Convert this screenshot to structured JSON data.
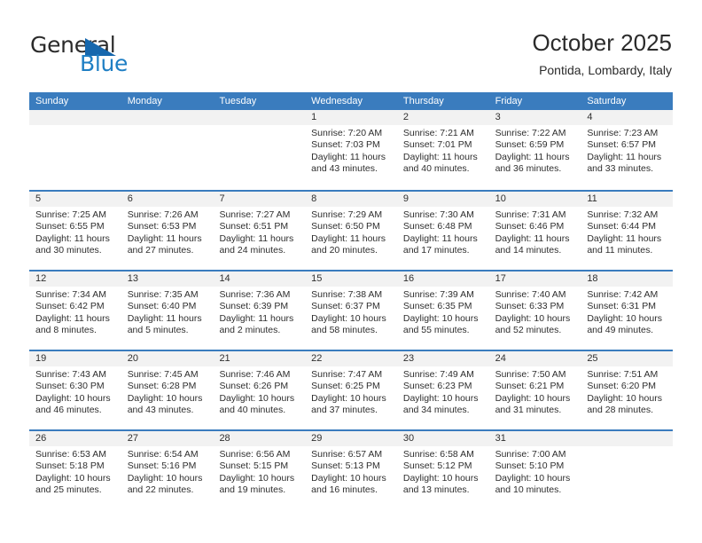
{
  "brand": {
    "name_part1": "General",
    "name_part2": "Blue",
    "accent_color": "#1667ad",
    "text_color": "#2b2b2b"
  },
  "header": {
    "month_title": "October 2025",
    "location": "Pontida, Lombardy, Italy"
  },
  "calendar": {
    "header_color": "#3a7cbe",
    "day_band_color": "#f2f2f2",
    "weekdays": [
      "Sunday",
      "Monday",
      "Tuesday",
      "Wednesday",
      "Thursday",
      "Friday",
      "Saturday"
    ],
    "weeks": [
      [
        {
          "day": "",
          "sunrise": "",
          "sunset": "",
          "daylight": "",
          "empty": true
        },
        {
          "day": "",
          "sunrise": "",
          "sunset": "",
          "daylight": "",
          "empty": true
        },
        {
          "day": "",
          "sunrise": "",
          "sunset": "",
          "daylight": "",
          "empty": true
        },
        {
          "day": "1",
          "sunrise": "Sunrise: 7:20 AM",
          "sunset": "Sunset: 7:03 PM",
          "daylight": "Daylight: 11 hours and 43 minutes.",
          "empty": false
        },
        {
          "day": "2",
          "sunrise": "Sunrise: 7:21 AM",
          "sunset": "Sunset: 7:01 PM",
          "daylight": "Daylight: 11 hours and 40 minutes.",
          "empty": false
        },
        {
          "day": "3",
          "sunrise": "Sunrise: 7:22 AM",
          "sunset": "Sunset: 6:59 PM",
          "daylight": "Daylight: 11 hours and 36 minutes.",
          "empty": false
        },
        {
          "day": "4",
          "sunrise": "Sunrise: 7:23 AM",
          "sunset": "Sunset: 6:57 PM",
          "daylight": "Daylight: 11 hours and 33 minutes.",
          "empty": false
        }
      ],
      [
        {
          "day": "5",
          "sunrise": "Sunrise: 7:25 AM",
          "sunset": "Sunset: 6:55 PM",
          "daylight": "Daylight: 11 hours and 30 minutes.",
          "empty": false
        },
        {
          "day": "6",
          "sunrise": "Sunrise: 7:26 AM",
          "sunset": "Sunset: 6:53 PM",
          "daylight": "Daylight: 11 hours and 27 minutes.",
          "empty": false
        },
        {
          "day": "7",
          "sunrise": "Sunrise: 7:27 AM",
          "sunset": "Sunset: 6:51 PM",
          "daylight": "Daylight: 11 hours and 24 minutes.",
          "empty": false
        },
        {
          "day": "8",
          "sunrise": "Sunrise: 7:29 AM",
          "sunset": "Sunset: 6:50 PM",
          "daylight": "Daylight: 11 hours and 20 minutes.",
          "empty": false
        },
        {
          "day": "9",
          "sunrise": "Sunrise: 7:30 AM",
          "sunset": "Sunset: 6:48 PM",
          "daylight": "Daylight: 11 hours and 17 minutes.",
          "empty": false
        },
        {
          "day": "10",
          "sunrise": "Sunrise: 7:31 AM",
          "sunset": "Sunset: 6:46 PM",
          "daylight": "Daylight: 11 hours and 14 minutes.",
          "empty": false
        },
        {
          "day": "11",
          "sunrise": "Sunrise: 7:32 AM",
          "sunset": "Sunset: 6:44 PM",
          "daylight": "Daylight: 11 hours and 11 minutes.",
          "empty": false
        }
      ],
      [
        {
          "day": "12",
          "sunrise": "Sunrise: 7:34 AM",
          "sunset": "Sunset: 6:42 PM",
          "daylight": "Daylight: 11 hours and 8 minutes.",
          "empty": false
        },
        {
          "day": "13",
          "sunrise": "Sunrise: 7:35 AM",
          "sunset": "Sunset: 6:40 PM",
          "daylight": "Daylight: 11 hours and 5 minutes.",
          "empty": false
        },
        {
          "day": "14",
          "sunrise": "Sunrise: 7:36 AM",
          "sunset": "Sunset: 6:39 PM",
          "daylight": "Daylight: 11 hours and 2 minutes.",
          "empty": false
        },
        {
          "day": "15",
          "sunrise": "Sunrise: 7:38 AM",
          "sunset": "Sunset: 6:37 PM",
          "daylight": "Daylight: 10 hours and 58 minutes.",
          "empty": false
        },
        {
          "day": "16",
          "sunrise": "Sunrise: 7:39 AM",
          "sunset": "Sunset: 6:35 PM",
          "daylight": "Daylight: 10 hours and 55 minutes.",
          "empty": false
        },
        {
          "day": "17",
          "sunrise": "Sunrise: 7:40 AM",
          "sunset": "Sunset: 6:33 PM",
          "daylight": "Daylight: 10 hours and 52 minutes.",
          "empty": false
        },
        {
          "day": "18",
          "sunrise": "Sunrise: 7:42 AM",
          "sunset": "Sunset: 6:31 PM",
          "daylight": "Daylight: 10 hours and 49 minutes.",
          "empty": false
        }
      ],
      [
        {
          "day": "19",
          "sunrise": "Sunrise: 7:43 AM",
          "sunset": "Sunset: 6:30 PM",
          "daylight": "Daylight: 10 hours and 46 minutes.",
          "empty": false
        },
        {
          "day": "20",
          "sunrise": "Sunrise: 7:45 AM",
          "sunset": "Sunset: 6:28 PM",
          "daylight": "Daylight: 10 hours and 43 minutes.",
          "empty": false
        },
        {
          "day": "21",
          "sunrise": "Sunrise: 7:46 AM",
          "sunset": "Sunset: 6:26 PM",
          "daylight": "Daylight: 10 hours and 40 minutes.",
          "empty": false
        },
        {
          "day": "22",
          "sunrise": "Sunrise: 7:47 AM",
          "sunset": "Sunset: 6:25 PM",
          "daylight": "Daylight: 10 hours and 37 minutes.",
          "empty": false
        },
        {
          "day": "23",
          "sunrise": "Sunrise: 7:49 AM",
          "sunset": "Sunset: 6:23 PM",
          "daylight": "Daylight: 10 hours and 34 minutes.",
          "empty": false
        },
        {
          "day": "24",
          "sunrise": "Sunrise: 7:50 AM",
          "sunset": "Sunset: 6:21 PM",
          "daylight": "Daylight: 10 hours and 31 minutes.",
          "empty": false
        },
        {
          "day": "25",
          "sunrise": "Sunrise: 7:51 AM",
          "sunset": "Sunset: 6:20 PM",
          "daylight": "Daylight: 10 hours and 28 minutes.",
          "empty": false
        }
      ],
      [
        {
          "day": "26",
          "sunrise": "Sunrise: 6:53 AM",
          "sunset": "Sunset: 5:18 PM",
          "daylight": "Daylight: 10 hours and 25 minutes.",
          "empty": false
        },
        {
          "day": "27",
          "sunrise": "Sunrise: 6:54 AM",
          "sunset": "Sunset: 5:16 PM",
          "daylight": "Daylight: 10 hours and 22 minutes.",
          "empty": false
        },
        {
          "day": "28",
          "sunrise": "Sunrise: 6:56 AM",
          "sunset": "Sunset: 5:15 PM",
          "daylight": "Daylight: 10 hours and 19 minutes.",
          "empty": false
        },
        {
          "day": "29",
          "sunrise": "Sunrise: 6:57 AM",
          "sunset": "Sunset: 5:13 PM",
          "daylight": "Daylight: 10 hours and 16 minutes.",
          "empty": false
        },
        {
          "day": "30",
          "sunrise": "Sunrise: 6:58 AM",
          "sunset": "Sunset: 5:12 PM",
          "daylight": "Daylight: 10 hours and 13 minutes.",
          "empty": false
        },
        {
          "day": "31",
          "sunrise": "Sunrise: 7:00 AM",
          "sunset": "Sunset: 5:10 PM",
          "daylight": "Daylight: 10 hours and 10 minutes.",
          "empty": false
        },
        {
          "day": "",
          "sunrise": "",
          "sunset": "",
          "daylight": "",
          "empty": true
        }
      ]
    ]
  }
}
